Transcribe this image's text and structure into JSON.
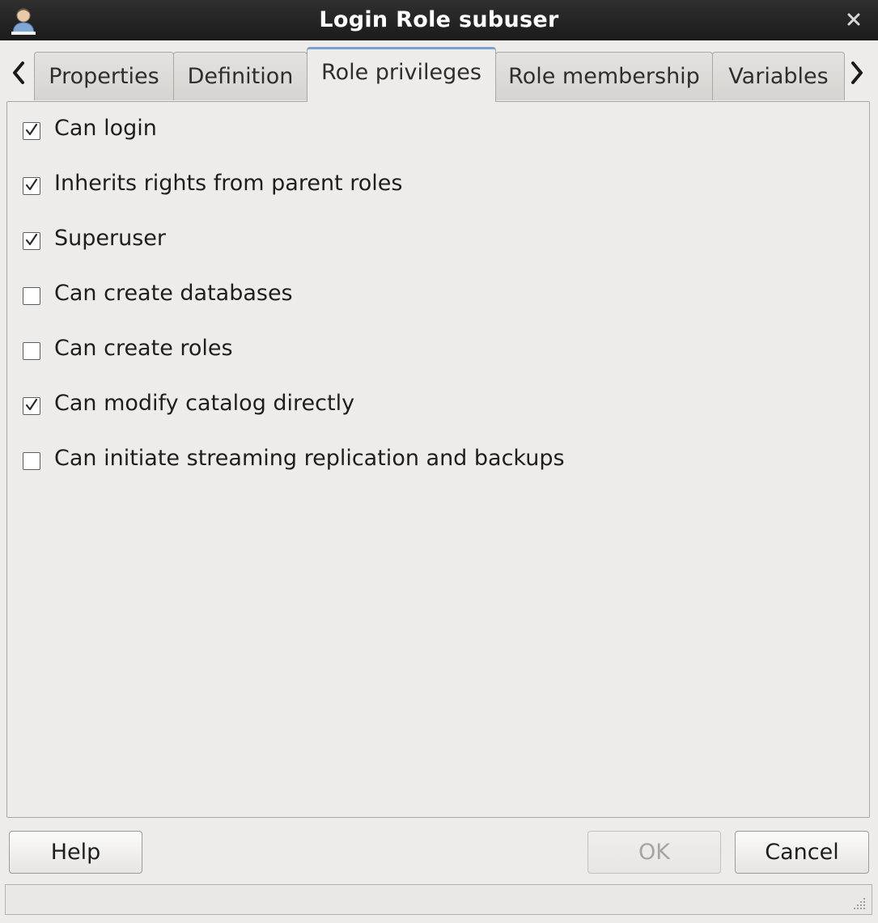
{
  "window": {
    "title": "Login Role subuser",
    "icon": "user-icon",
    "close_icon": "close-icon"
  },
  "tabs": [
    {
      "label": "Properties",
      "active": false
    },
    {
      "label": "Definition",
      "active": false
    },
    {
      "label": "Role privileges",
      "active": true
    },
    {
      "label": "Role membership",
      "active": false
    },
    {
      "label": "Variables",
      "active": false
    }
  ],
  "privileges": [
    {
      "label": "Can login",
      "checked": true
    },
    {
      "label": "Inherits rights from parent roles",
      "checked": true
    },
    {
      "label": "Superuser",
      "checked": true
    },
    {
      "label": "Can create databases",
      "checked": false
    },
    {
      "label": "Can create roles",
      "checked": false
    },
    {
      "label": "Can modify catalog directly",
      "checked": true
    },
    {
      "label": "Can initiate streaming replication and backups",
      "checked": false
    }
  ],
  "buttons": {
    "help": "Help",
    "ok": "OK",
    "ok_enabled": false,
    "cancel": "Cancel"
  },
  "colors": {
    "titlebar": "#1b1b1b",
    "active_tab_accent": "#7aa0d6",
    "background": "#edeceb"
  }
}
